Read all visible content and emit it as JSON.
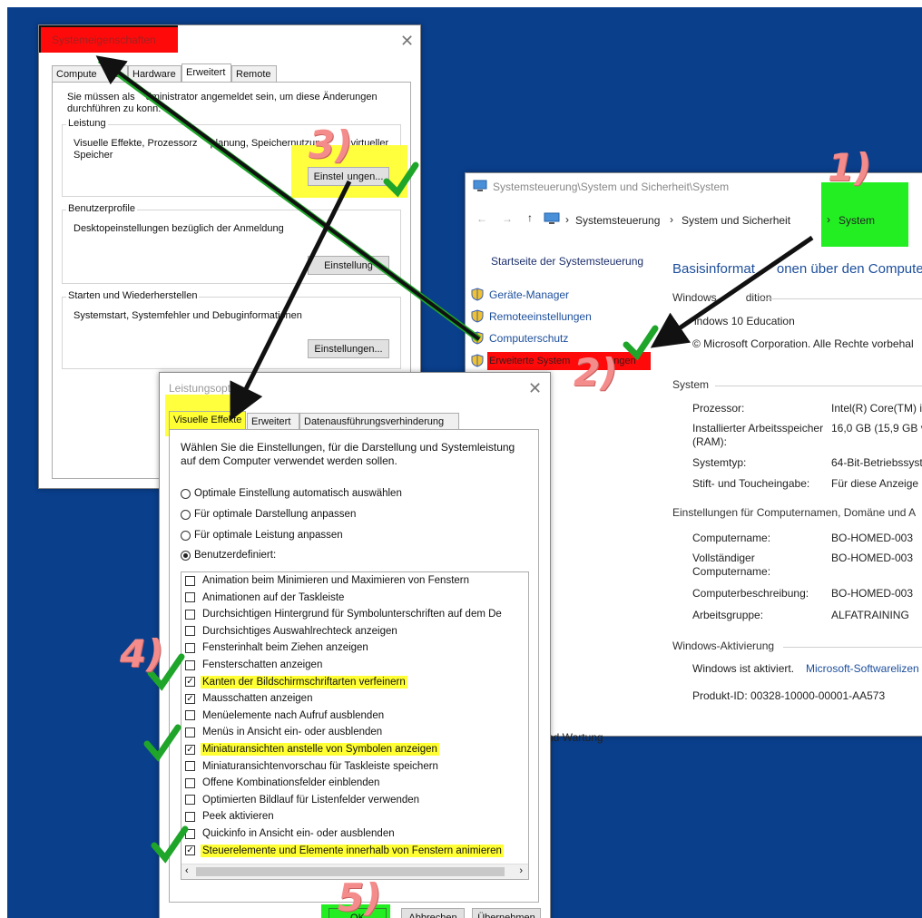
{
  "system_props": {
    "title": "Systemeigenschaften",
    "tabs": [
      "Computername",
      "Hardware",
      "Erweitert",
      "Remote"
    ],
    "tab_first_visible": "Compute",
    "tab_first_tail": "e",
    "admin_note_1": "Sie müssen als",
    "admin_note_1b": "dministrator angemeldet sein, um diese Änderungen",
    "admin_note_2": "durchführen zu kon",
    "admin_note_2b": "n.",
    "perf_group": "Leistung",
    "perf_desc_1": "Visuelle Effekte, Prozessorz",
    "perf_desc_1b": "planung, Speichernutzung",
    "perf_desc_1c": "d virtueller",
    "perf_desc_2": "Speicher",
    "profiles_group": "Benutzerprofile",
    "profiles_desc": "Desktopeinstellungen bezüglich der Anmeldung",
    "startup_group": "Starten und Wiederherstellen",
    "startup_desc": "Systemstart, Systemfehler und Debuginformationen",
    "settings_button": "Einstellungen...",
    "settings_button_1": "Einstel",
    "settings_button_1b": "ungen...",
    "settings_button_2": "Einstellung"
  },
  "sysctl": {
    "title": "Systemsteuerung\\System und Sicherheit\\System",
    "crumbs": [
      "Systemsteuerung",
      "System und Sicherheit",
      "System"
    ],
    "sidebar_home": "Startseite der Systemsteuerung",
    "links": [
      "Geräte-Manager",
      "Remoteeinstellungen",
      "Computerschutz",
      "Erweiterte System",
      "ngen"
    ],
    "heading_a": "Basisinformat",
    "heading_b": "onen über den Compute",
    "edition_section_a": "Windows",
    "edition_section_b": "dition",
    "edition": "indows 10 Education",
    "copyright": "© Microsoft Corporation. Alle Rechte vorbehal",
    "system_section": "System",
    "rows": [
      {
        "k": "Prozessor:",
        "v": "Intel(R) Core(TM) i"
      },
      {
        "k": "Installierter Arbeitsspeicher (RAM):",
        "v": "16,0 GB (15,9 GB ve"
      },
      {
        "k": "Systemtyp:",
        "v": "64-Bit-Betriebssyst"
      },
      {
        "k": "Stift- und Toucheingabe:",
        "v": "Für diese Anzeige i"
      }
    ],
    "computer_section": "Einstellungen für Computernamen, Domäne und A",
    "rows2": [
      {
        "k": "Computername:",
        "v": "BO-HOMED-003"
      },
      {
        "k": "Vollständiger Computername:",
        "v": "BO-HOMED-003"
      },
      {
        "k": "Computerbeschreibung:",
        "v": "BO-HOMED-003"
      },
      {
        "k": "Arbeitsgruppe:",
        "v": "ALFATRAINING"
      }
    ],
    "activation_section": "Windows-Aktivierung",
    "activation_status": "Windows ist aktiviert.",
    "activation_link": "Microsoft-Softwarelizen",
    "product_id": "Produkt-ID: 00328-10000-00001-AA573",
    "see_also": "nd Wartung"
  },
  "perf": {
    "title": "Leistungsopti",
    "tabs": [
      "Visuelle Effekte",
      "Erweitert",
      "Datenausführungsverhinderung"
    ],
    "intro": "Wählen Sie die Einstellungen, für die Darstellung und Systemleistung auf dem Computer verwendet werden sollen.",
    "radios": [
      {
        "label": "Optimale Einstellung automatisch auswählen",
        "checked": false
      },
      {
        "label": "Für optimale Darstellung anpassen",
        "checked": false
      },
      {
        "label": "Für optimale Leistung anpassen",
        "checked": false
      },
      {
        "label": "Benutzerdefiniert:",
        "checked": true
      }
    ],
    "items": [
      {
        "label": "Animation beim Minimieren und Maximieren von Fenstern",
        "checked": false,
        "hl": false
      },
      {
        "label": "Animationen auf der Taskleiste",
        "checked": false,
        "hl": false
      },
      {
        "label": "Durchsichtigen Hintergrund für Symbolunterschriften auf dem De",
        "checked": false,
        "hl": false
      },
      {
        "label": "Durchsichtiges Auswahlrechteck anzeigen",
        "checked": false,
        "hl": false
      },
      {
        "label": "Fensterinhalt beim Ziehen anzeigen",
        "checked": false,
        "hl": false
      },
      {
        "label": "Fensterschatten anzeigen",
        "checked": false,
        "hl": false
      },
      {
        "label": "Kanten der Bildschirmschriftarten verfeinern",
        "checked": true,
        "hl": true
      },
      {
        "label": "Mausschatten anzeigen",
        "checked": true,
        "hl": false
      },
      {
        "label": "Menüelemente nach Aufruf ausblenden",
        "checked": false,
        "hl": false
      },
      {
        "label": "Menüs in Ansicht ein- oder ausblenden",
        "checked": false,
        "hl": false
      },
      {
        "label": "Miniaturansichten anstelle von Symbolen anzeigen",
        "checked": true,
        "hl": true
      },
      {
        "label": "Miniaturansichtenvorschau für Taskleiste speichern",
        "checked": false,
        "hl": false
      },
      {
        "label": "Offene Kombinationsfelder einblenden",
        "checked": false,
        "hl": false
      },
      {
        "label": "Optimierten Bildlauf für Listenfelder verwenden",
        "checked": false,
        "hl": false
      },
      {
        "label": "Peek aktivieren",
        "checked": false,
        "hl": false
      },
      {
        "label": "Quickinfo in Ansicht ein- oder ausblenden",
        "checked": false,
        "hl": false
      },
      {
        "label": "Steuerelemente und Elemente innerhalb von Fenstern animieren",
        "checked": true,
        "hl": true
      }
    ],
    "ok": "OK",
    "cancel": "Abbrechen",
    "apply": "Übernehmen"
  },
  "annotations": [
    "1)",
    "2)",
    "3)",
    "4)",
    "5)"
  ],
  "colors": {
    "desktop": "#0a3f8c",
    "arrow_black": "#111111",
    "arrow_green": "#1fa52a",
    "highlight_yellow": "#ffff33",
    "highlight_red": "#ff0a0a",
    "highlight_green": "#22ee22",
    "annotation": "#f58c8c"
  }
}
